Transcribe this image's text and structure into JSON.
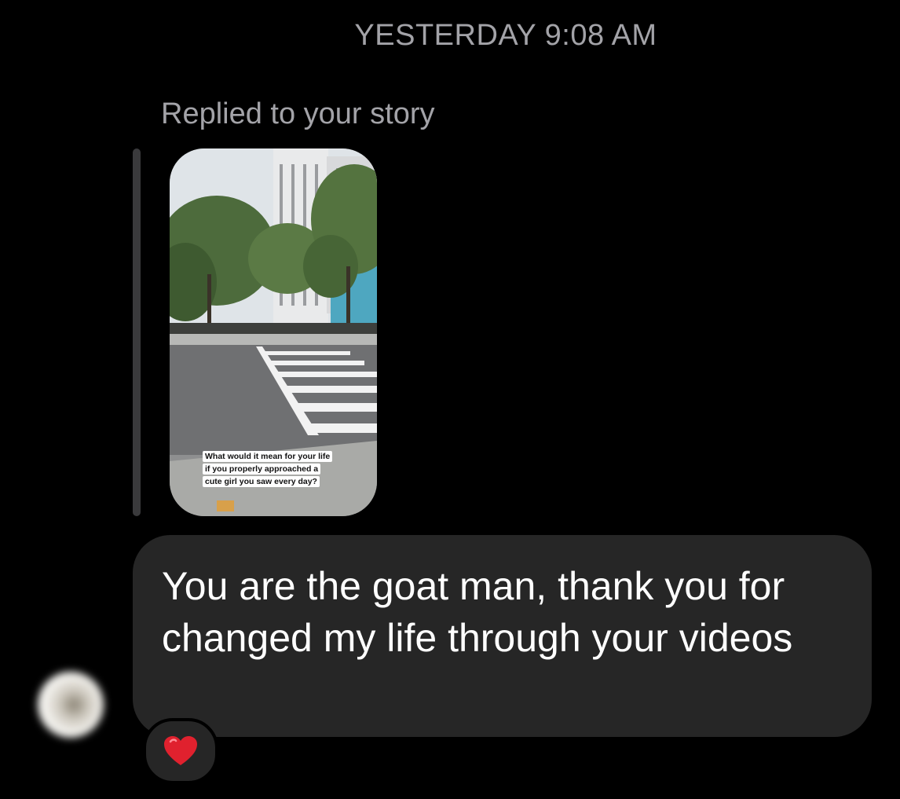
{
  "timestamp": "YESTERDAY 9:08 AM",
  "story_reply": {
    "label": "Replied to your story",
    "caption_lines": [
      "What would it mean for your life",
      "if you properly approached a",
      "cute girl you saw every day?"
    ]
  },
  "message": {
    "text": "You are the goat man, thank you for changed my life through your videos"
  },
  "reaction": {
    "emoji": "heart-icon",
    "color": "#e0212e"
  },
  "colors": {
    "background": "#000000",
    "bubble": "#262626",
    "secondary_text": "#a3a3a8"
  }
}
